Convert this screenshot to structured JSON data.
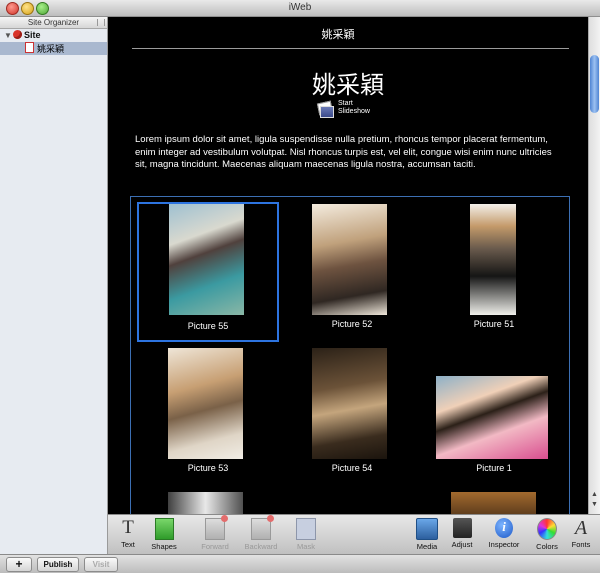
{
  "window": {
    "title": "iWeb"
  },
  "sidebar": {
    "header": "Site Organizer",
    "site_label": "Site",
    "page_label": "姚采穎"
  },
  "page": {
    "nav_title": "姚采穎",
    "title": "姚采穎",
    "slideshow_line1": "Start",
    "slideshow_line2": "Slideshow",
    "body_text": "Lorem ipsum dolor sit amet, ligula suspendisse nulla pretium, rhoncus tempor placerat fermentum, enim integer ad vestibulum volutpat. Nisl rhoncus turpis est, vel elit, congue wisi enim nunc ultricies sit, magna tincidunt. Maecenas aliquam maecenas ligula nostra, accumsan taciti."
  },
  "gallery": {
    "items": [
      {
        "caption": "Picture 55"
      },
      {
        "caption": "Picture 52"
      },
      {
        "caption": "Picture 51"
      },
      {
        "caption": "Picture 53"
      },
      {
        "caption": "Picture 54"
      },
      {
        "caption": "Picture 1"
      }
    ]
  },
  "toolbar": {
    "text": "Text",
    "shapes": "Shapes",
    "forward": "Forward",
    "backward": "Backward",
    "mask": "Mask",
    "media": "Media",
    "adjust": "Adjust",
    "inspector": "Inspector",
    "colors": "Colors",
    "fonts": "Fonts",
    "text_glyph": "T",
    "inspector_glyph": "i",
    "fonts_glyph": "A"
  },
  "bottombar": {
    "add": "+",
    "publish": "Publish",
    "visit": "Visit"
  },
  "colors": {
    "selection_border": "#2d74e0",
    "sidebar_selected": "#a9b8cf",
    "page_background": "#000000"
  }
}
